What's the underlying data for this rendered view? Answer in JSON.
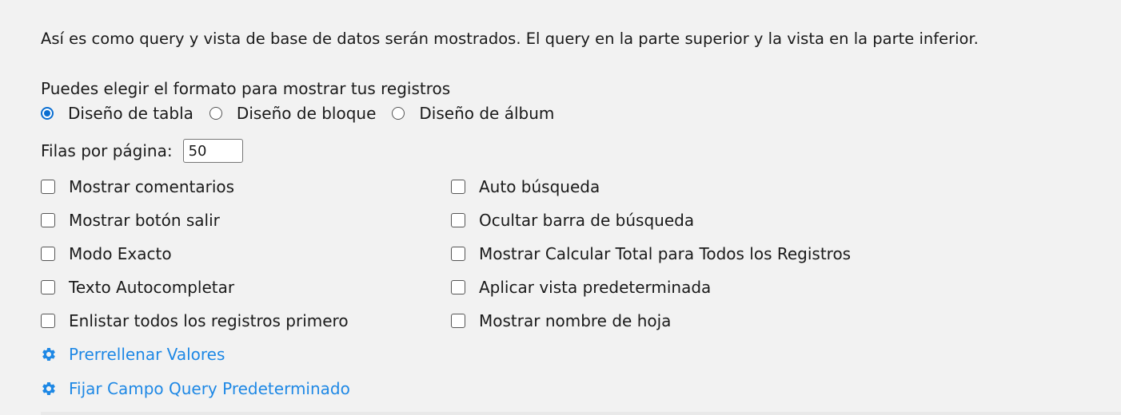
{
  "intro_text": "Así es como query y vista de base de datos serán mostrados. El query en la parte superior y la vista en la parte inferior.",
  "format": {
    "label": "Puedes elegir el formato para mostrar tus registros",
    "options": [
      {
        "label": "Diseño de tabla",
        "checked": true
      },
      {
        "label": "Diseño de bloque",
        "checked": false
      },
      {
        "label": "Diseño de álbum",
        "checked": false
      }
    ]
  },
  "rows_per_page": {
    "label": "Filas por página:",
    "value": "50"
  },
  "checkboxes_left": [
    {
      "label": "Mostrar comentarios",
      "checked": false
    },
    {
      "label": "Mostrar botón salir",
      "checked": false
    },
    {
      "label": "Modo Exacto",
      "checked": false
    },
    {
      "label": "Texto Autocompletar",
      "checked": false
    },
    {
      "label": "Enlistar todos los registros primero",
      "checked": false
    }
  ],
  "checkboxes_right": [
    {
      "label": "Auto búsqueda",
      "checked": false
    },
    {
      "label": "Ocultar barra de búsqueda",
      "checked": false
    },
    {
      "label": "Mostrar Calcular Total para Todos los Registros",
      "checked": false
    },
    {
      "label": "Aplicar vista predeterminada",
      "checked": false
    },
    {
      "label": "Mostrar nombre de hoja",
      "checked": false
    }
  ],
  "links": [
    {
      "label": "Prerrellenar Valores",
      "icon": "gear-icon"
    },
    {
      "label": "Fijar Campo Query Predeterminado",
      "icon": "gear-icon"
    }
  ],
  "colors": {
    "link": "#1e88e5",
    "radio_checked": "#0a6ed1",
    "background": "#f2f2f2"
  }
}
